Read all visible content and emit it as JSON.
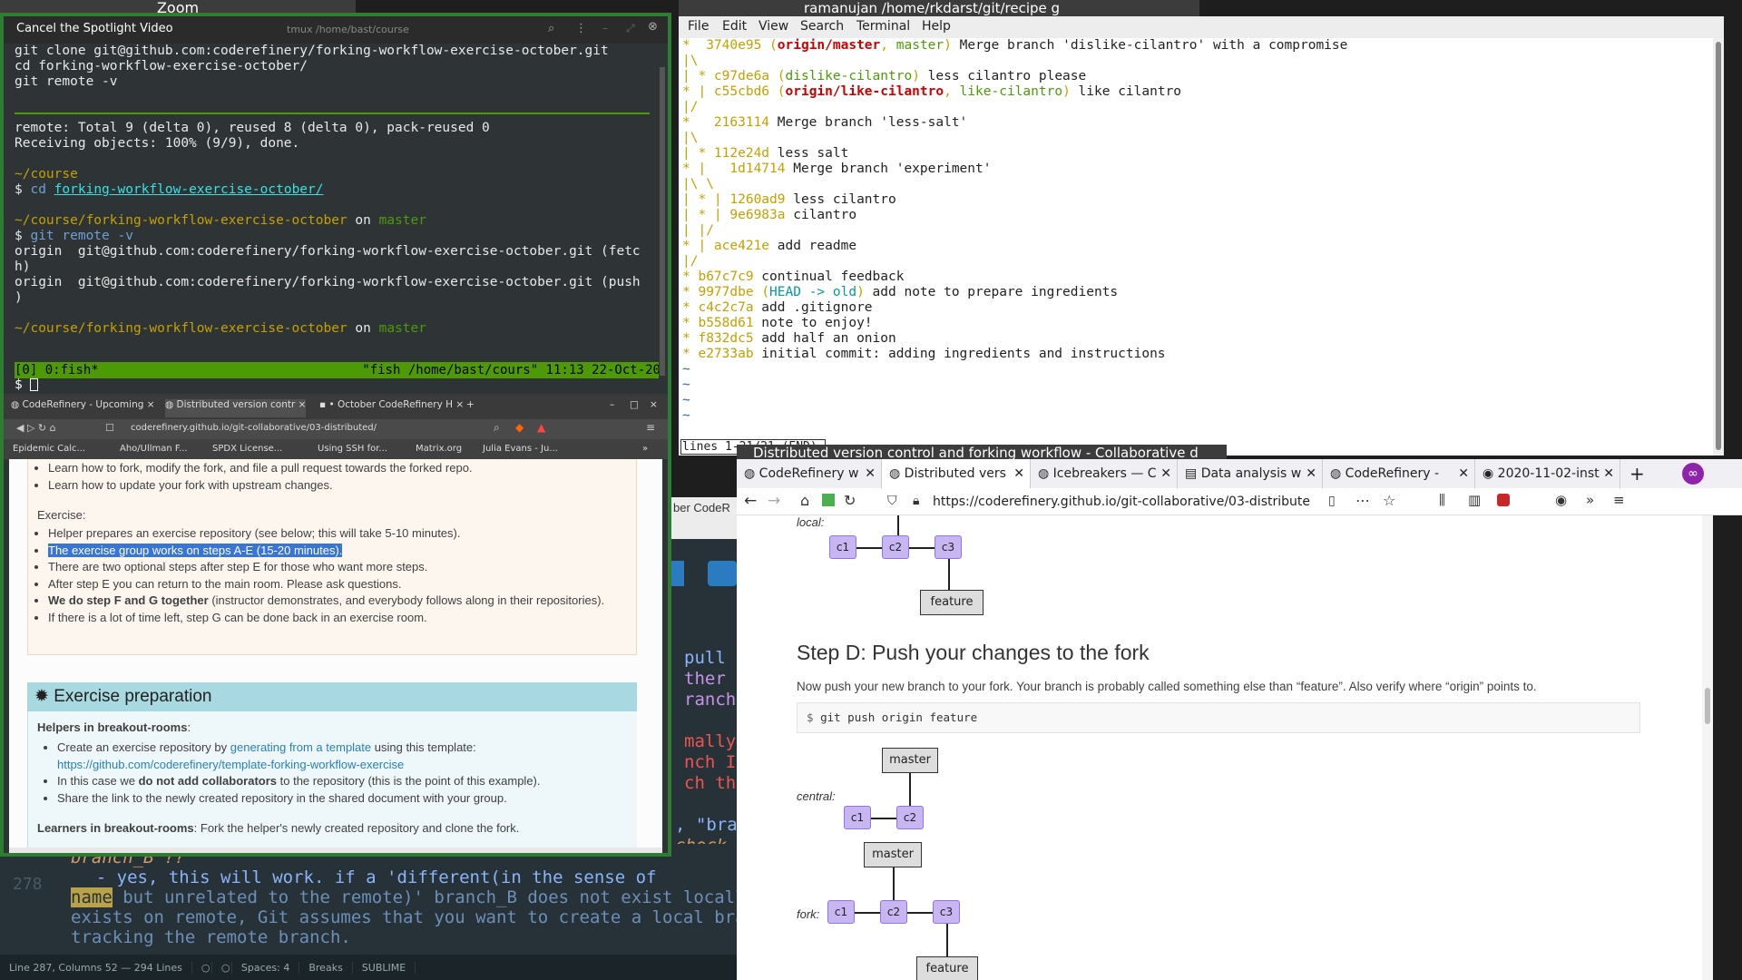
{
  "zoom": {
    "label": "Zoom",
    "spotlight": "Cancel the Spotlight Video",
    "term_title": "tmux /home/bast/course",
    "top_lines": [
      "git clone git@github.com:coderefinery/forking-workflow-exercise-october.git",
      "cd forking-workflow-exercise-october/",
      "git remote -v"
    ],
    "out1": "remote: Total 9 (delta 0), reused 8 (delta 0), pack-reused 0",
    "out2": "Receiving objects: 100% (9/9), done.",
    "p_course": "~/course",
    "cd_cmd": "cd",
    "cd_arg": "forking-workflow-exercise-october/",
    "p_repo": "~/course/forking-workflow-exercise-october",
    "on": "on",
    "branch": "master",
    "remote_cmd": "git remote -v",
    "origin1a": "origin  git@github.com:coderefinery/forking-workflow-exercise-october.git (fetc",
    "origin1b": "h)",
    "origin2a": "origin  git@github.com:coderefinery/forking-workflow-exercise-october.git (push",
    "origin2b": ")",
    "tmux_left": "[0] 0:fish*",
    "tmux_right": "\"fish /home/bast/cours\" 11:13 22-Oct-20",
    "browser": {
      "tabs": [
        "CodeRefinery - Upcoming",
        "Distributed version contr",
        "• October CodeRefinery H"
      ],
      "url": "coderefinery.github.io/git-collaborative/03-distributed/",
      "bookmarks": [
        "Epidemic Calc...",
        "Aho/Ullman F...",
        "SPDX License...",
        "Using SSH for...",
        "Matrix.org",
        "Julia Evans - Ju..."
      ],
      "goal1": "Learn how to fork, modify the fork, and file a pull request towards the forked repo.",
      "goal2": "Learn how to update your fork with upstream changes.",
      "exercise": "Exercise:",
      "ex1": "Helper prepares an exercise repository (see below; this will take 5-10 minutes).",
      "ex2": "The exercise group works on steps A-E (15-20 minutes).",
      "ex3": "There are two optional steps after step E for those who want more steps.",
      "ex4": "After step E you can return to the main room. Please ask questions.",
      "ex5_b": "We do step F and G together",
      "ex5": " (instructor demonstrates, and everybody follows along in their repositories).",
      "ex6": "If there is a lot of time left, step G can be done back in an exercise room.",
      "prep_title": "Exercise preparation",
      "helpers": "Helpers in breakout-rooms",
      "h1a": "Create an exercise repository by ",
      "h1link": "generating from a template",
      "h1b": " using this template:",
      "h1url": "https://github.com/coderefinery/template-forking-workflow-exercise",
      "h2a": "In this case we ",
      "h2b": "do not add collaborators",
      "h2c": " to the repository (this is the point of this example).",
      "h3": "Share the link to the newly created repository in the shared document with your group.",
      "learners": "Learners in breakout-rooms",
      "learners_text": ": Fork the helper's newly created repository and clone the fork."
    }
  },
  "sublime": {
    "line_no": "278",
    "l1": "branch_B ??",
    "l2": "    - yes, this will work. if a 'different(in the sense of",
    "l3a": "name",
    "l3b": " but unrelated to the remote)' branch_B does not exist locall",
    "l4": "exists on remote, Git assumes that you want to create a local bra",
    "l5": "tracking the remote branch.",
    "status": [
      "Line 287, Columns 52 — 294 Lines",
      "Spaces: 4",
      "Breaks",
      "SUBLIME"
    ]
  },
  "mid": {
    "lines": [
      "pull",
      "ther",
      "ranche",
      "",
      "mally",
      "nch I",
      "ch the",
      "",
      ", \"bra",
      "check"
    ],
    "header": "ber CodeR"
  },
  "git_terminal": {
    "title": "ramanujan  /home/rkdarst/git/recipe  g",
    "menu": [
      "File",
      "Edit",
      "View",
      "Search",
      "Terminal",
      "Help"
    ],
    "status": "lines 1-21/21 (END)",
    "log": [
      {
        "g": "*  ",
        "h": "3740e95",
        "refs": "(origin/master, master)",
        "msg": " Merge branch 'dislike-cilantro' with a compromise"
      },
      {
        "g": "|\\",
        "h": "",
        "refs": "",
        "msg": ""
      },
      {
        "g": "| * ",
        "h": "c97de6a",
        "refs": "(dislike-cilantro)",
        "msg": " less cilantro please"
      },
      {
        "g": "* | ",
        "h": "c55cbd6",
        "refs": "(origin/like-cilantro, like-cilantro)",
        "msg": " like cilantro"
      },
      {
        "g": "|/",
        "h": "",
        "refs": "",
        "msg": ""
      },
      {
        "g": "*   ",
        "h": "2163114",
        "refs": "",
        "msg": " Merge branch 'less-salt'"
      },
      {
        "g": "|\\",
        "h": "",
        "refs": "",
        "msg": ""
      },
      {
        "g": "| * ",
        "h": "112e24d",
        "refs": "",
        "msg": " less salt"
      },
      {
        "g": "* |   ",
        "h": "1d14714",
        "refs": "",
        "msg": " Merge branch 'experiment'"
      },
      {
        "g": "|\\ \\",
        "h": "",
        "refs": "",
        "msg": ""
      },
      {
        "g": "| * | ",
        "h": "1260ad9",
        "refs": "",
        "msg": " less cilantro"
      },
      {
        "g": "| * | ",
        "h": "9e6983a",
        "refs": "",
        "msg": " cilantro"
      },
      {
        "g": "| |/",
        "h": "",
        "refs": "",
        "msg": ""
      },
      {
        "g": "* | ",
        "h": "ace421e",
        "refs": "",
        "msg": " add readme"
      },
      {
        "g": "|/",
        "h": "",
        "refs": "",
        "msg": ""
      },
      {
        "g": "* ",
        "h": "b67c7c9",
        "refs": "",
        "msg": " continual feedback"
      },
      {
        "g": "* ",
        "h": "9977dbe",
        "refs": "(HEAD -> old)",
        "msg": " add note to prepare ingredients"
      },
      {
        "g": "* ",
        "h": "c4c2c7a",
        "refs": "",
        "msg": " add .gitignore"
      },
      {
        "g": "* ",
        "h": "b558d61",
        "refs": "",
        "msg": " note to enjoy!"
      },
      {
        "g": "* ",
        "h": "f832dc5",
        "refs": "",
        "msg": " add half an onion"
      },
      {
        "g": "* ",
        "h": "e2733ab",
        "refs": "",
        "msg": " initial commit: adding ingredients and instructions"
      }
    ]
  },
  "firefox": {
    "title": "Distributed version control and forking workflow - Collaborative d",
    "tabs": [
      "CodeRefinery w",
      "Distributed vers",
      "Icebreakers — C",
      "Data analysis w",
      "CodeRefinery - ",
      "2020-11-02-inst"
    ],
    "url": "https://coderefinery.github.io/git-collaborative/03-distribute",
    "local_label": "local:",
    "step_title": "Step D: Push your changes to the fork",
    "step_text": "Now push your new branch to your fork. Your branch is probably called something else than “feature”. Also verify where “origin” points to.",
    "code_prompt": "$",
    "code": "git push origin feature",
    "central_label": "central:",
    "fork_label": "fork:",
    "c1": "c1",
    "c2": "c2",
    "c3": "c3",
    "feature": "feature",
    "master": "master"
  }
}
